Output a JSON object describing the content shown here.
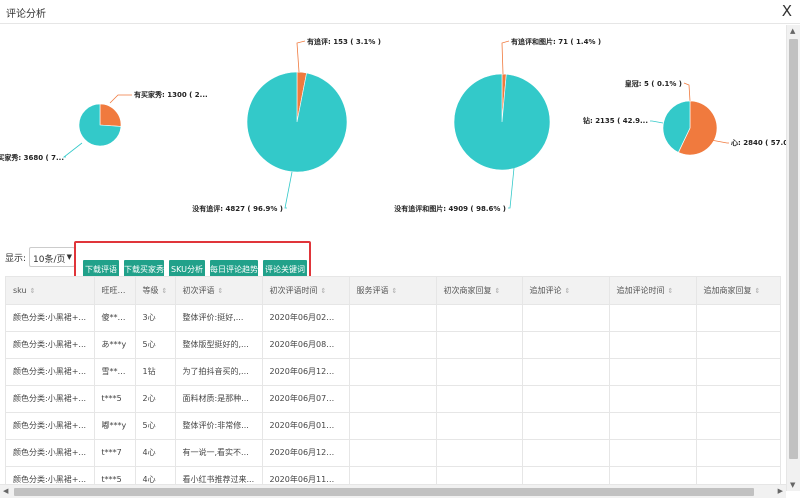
{
  "window": {
    "title": "评论分析",
    "close_label": "X"
  },
  "colors": {
    "teal": "#33c9c9",
    "orange": "#f07a3e",
    "button": "#21a18a",
    "highlight_border": "#e0353a"
  },
  "charts": [
    {
      "slices": [
        {
          "value": 1300,
          "label": "有买家秀: 1300 ( 2...",
          "color": "#f07a3e"
        },
        {
          "value": 3680,
          "label": "没有买家秀: 3680 ( 7...",
          "color": "#33c9c9"
        }
      ]
    },
    {
      "slices": [
        {
          "value": 153,
          "label": "有追评: 153 ( 3.1% )",
          "color": "#f07a3e"
        },
        {
          "value": 4827,
          "label": "没有追评: 4827 ( 96.9% )",
          "color": "#33c9c9"
        }
      ]
    },
    {
      "slices": [
        {
          "value": 71,
          "label": "有追评和图片: 71 ( 1.4% )",
          "color": "#f07a3e"
        },
        {
          "value": 4909,
          "label": "没有追评和图片: 4909 ( 98.6% )",
          "color": "#33c9c9"
        }
      ]
    },
    {
      "slices": [
        {
          "value": 2840,
          "label": "心: 2840 ( 57.0...",
          "color": "#f07a3e"
        },
        {
          "value": 5,
          "label": "皇冠: 5 ( 0.1% )",
          "color": "#f07a3e"
        },
        {
          "value": 2135,
          "label": "钻: 2135 ( 42.9...",
          "color": "#33c9c9"
        }
      ]
    }
  ],
  "toolbar": {
    "show_label": "显示:",
    "page_size": "10条/页",
    "buttons": [
      "下载评语",
      "下载买家秀",
      "SKU分析",
      "每日评论趋势",
      "评论关键词"
    ]
  },
  "table": {
    "columns": [
      "sku",
      "旺旺名",
      "等级",
      "初次评语",
      "初次评语时间",
      "服务评语",
      "初次商家回复",
      "追加评论",
      "追加评论时间",
      "追加商家回复"
    ],
    "rows": [
      [
        "颜色分类:小黑裙+...",
        "傻***燕",
        "3心",
        "整体评价:挺好,...",
        "2020年06月02日 0...",
        "",
        "",
        "",
        "",
        ""
      ],
      [
        "颜色分类:小黑裙+...",
        "あ***y",
        "5心",
        "整体版型挺好的,...",
        "2020年06月08日 1...",
        "",
        "",
        "",
        "",
        ""
      ],
      [
        "颜色分类:小黑裙+...",
        "雪***沫",
        "1钻",
        "为了拍抖音买的,...",
        "2020年06月12日 1...",
        "",
        "",
        "",
        "",
        ""
      ],
      [
        "颜色分类:小黑裙+...",
        "t***5",
        "2心",
        "面料材质:是那种...",
        "2020年06月07日 1...",
        "",
        "",
        "",
        "",
        ""
      ],
      [
        "颜色分类:小黑裙+...",
        "嘟***y",
        "5心",
        "整体评价:非常修...",
        "2020年06月01日 1...",
        "",
        "",
        "",
        "",
        ""
      ],
      [
        "颜色分类:小黑裙+...",
        "t***7",
        "4心",
        "有一说一,看实不...",
        "2020年06月12日 2...",
        "",
        "",
        "",
        "",
        ""
      ],
      [
        "颜色分类:小黑裙+...",
        "t***5",
        "4心",
        "看小红书推荐过来...",
        "2020年06月11日 0...",
        "",
        "",
        "",
        "",
        ""
      ]
    ]
  }
}
